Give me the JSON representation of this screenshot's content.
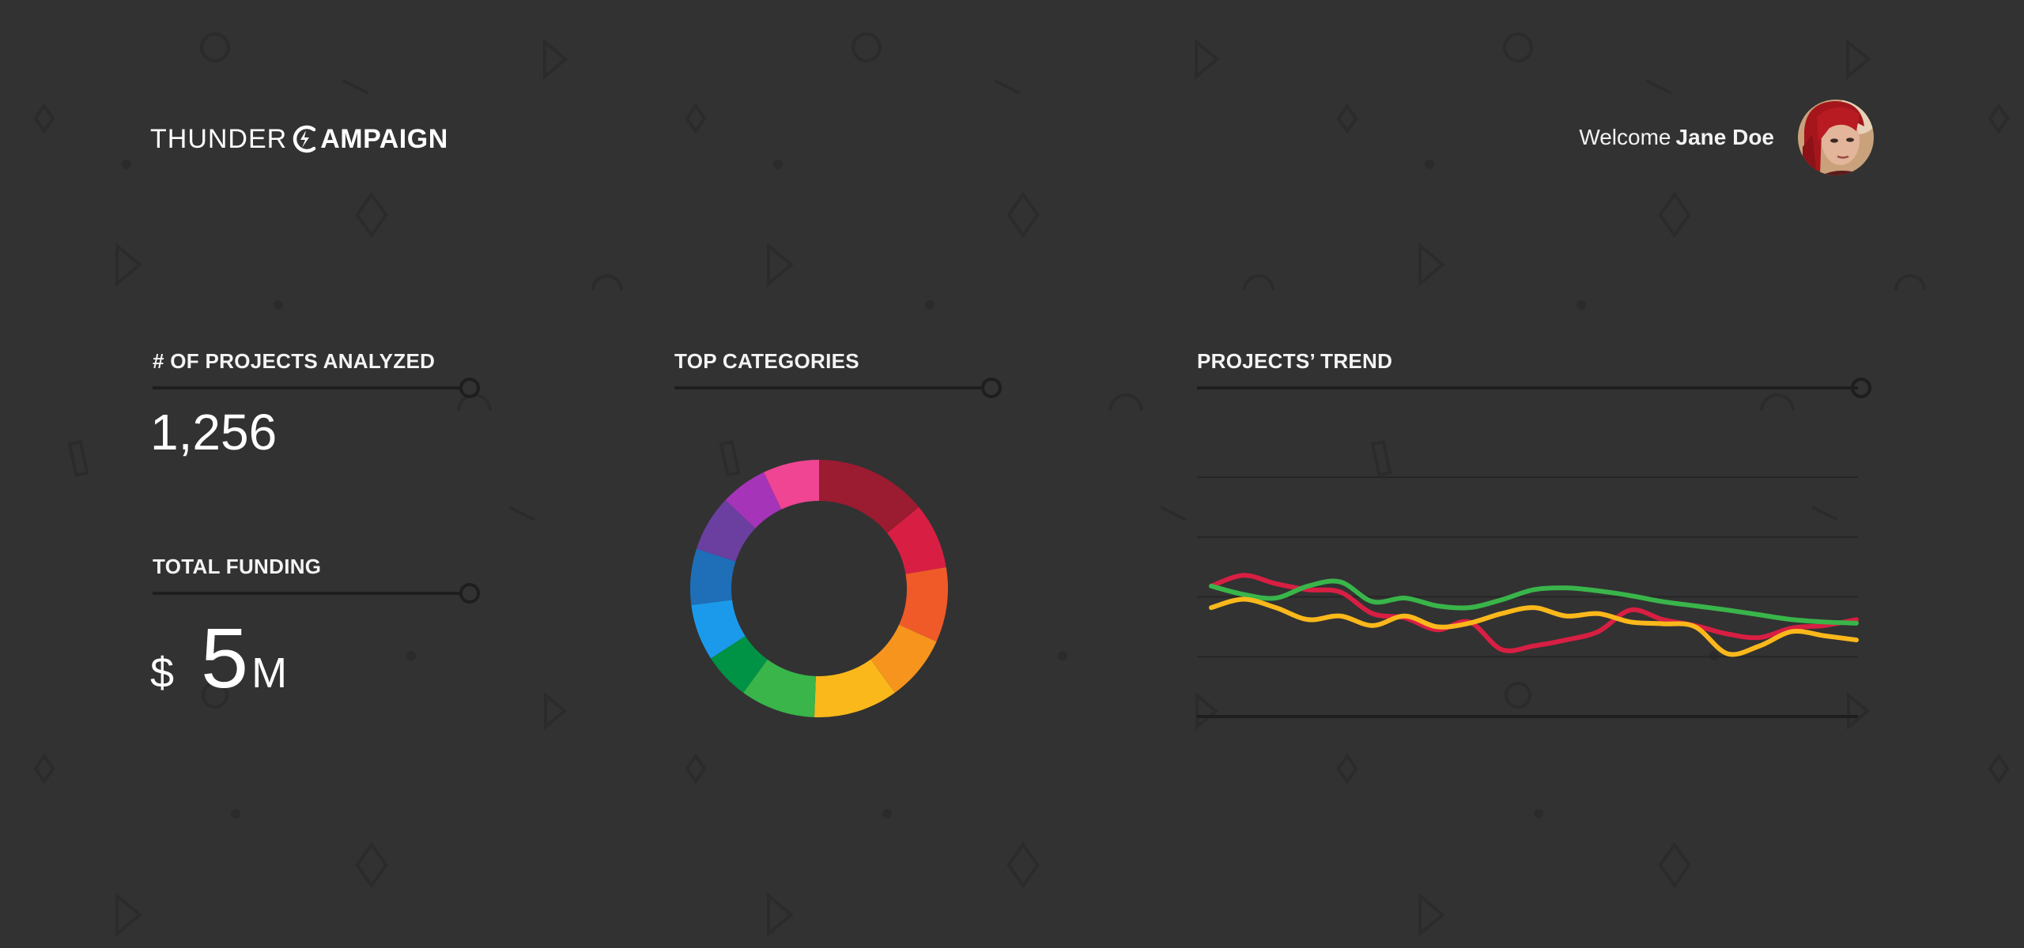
{
  "header": {
    "logo_thin": "THUNDER",
    "logo_bold": "AMPAIGN",
    "logo_icon": "lightning-c-icon",
    "welcome_prefix": "Welcome",
    "user_name": "Jane Doe"
  },
  "colors": {
    "background": "#323232",
    "rule": "#1e1e1e",
    "text": "#ffffff"
  },
  "projects": {
    "title": "# OF PROJECTS ANALYZED",
    "value": "1,256"
  },
  "funding": {
    "title": "TOTAL FUNDING",
    "currency": "$",
    "amount": "5",
    "unit": "M"
  },
  "categories": {
    "title": "TOP CATEGORIES"
  },
  "trend": {
    "title": "PROJECTS’ TREND"
  },
  "chart_data": [
    {
      "type": "pie",
      "variant": "donut",
      "values": [
        12,
        7,
        8,
        7,
        9,
        8,
        5,
        6,
        6,
        6,
        5,
        6
      ],
      "colors": [
        "#9b1b30",
        "#d81f43",
        "#f05a28",
        "#f7941d",
        "#fbb81b",
        "#39b54a",
        "#009245",
        "#1b9aeb",
        "#1e6fb8",
        "#6a3fa0",
        "#a534b8",
        "#ef4593"
      ]
    },
    {
      "type": "line",
      "x": [
        0,
        1,
        2,
        3,
        4,
        5,
        6,
        7,
        8,
        9,
        10,
        11,
        12,
        13,
        14,
        15,
        16,
        17,
        18,
        19,
        20
      ],
      "ylim": [
        0,
        4
      ],
      "grid": true,
      "series": [
        {
          "color": "#d81f43",
          "values": [
            2.18,
            2.36,
            2.22,
            2.12,
            2.08,
            1.72,
            1.65,
            1.45,
            1.58,
            1.12,
            1.18,
            1.28,
            1.42,
            1.78,
            1.62,
            1.52,
            1.38,
            1.32,
            1.48,
            1.52,
            1.62
          ]
        },
        {
          "color": "#39b54a",
          "values": [
            2.18,
            2.04,
            1.98,
            2.18,
            2.25,
            1.92,
            1.98,
            1.85,
            1.82,
            1.95,
            2.12,
            2.15,
            2.1,
            2.02,
            1.92,
            1.85,
            1.78,
            1.7,
            1.62,
            1.58,
            1.56
          ]
        },
        {
          "color": "#fbb81b",
          "values": [
            1.82,
            1.96,
            1.82,
            1.62,
            1.68,
            1.52,
            1.68,
            1.5,
            1.56,
            1.72,
            1.82,
            1.68,
            1.72,
            1.58,
            1.55,
            1.5,
            1.05,
            1.18,
            1.42,
            1.35,
            1.28
          ]
        }
      ]
    }
  ]
}
